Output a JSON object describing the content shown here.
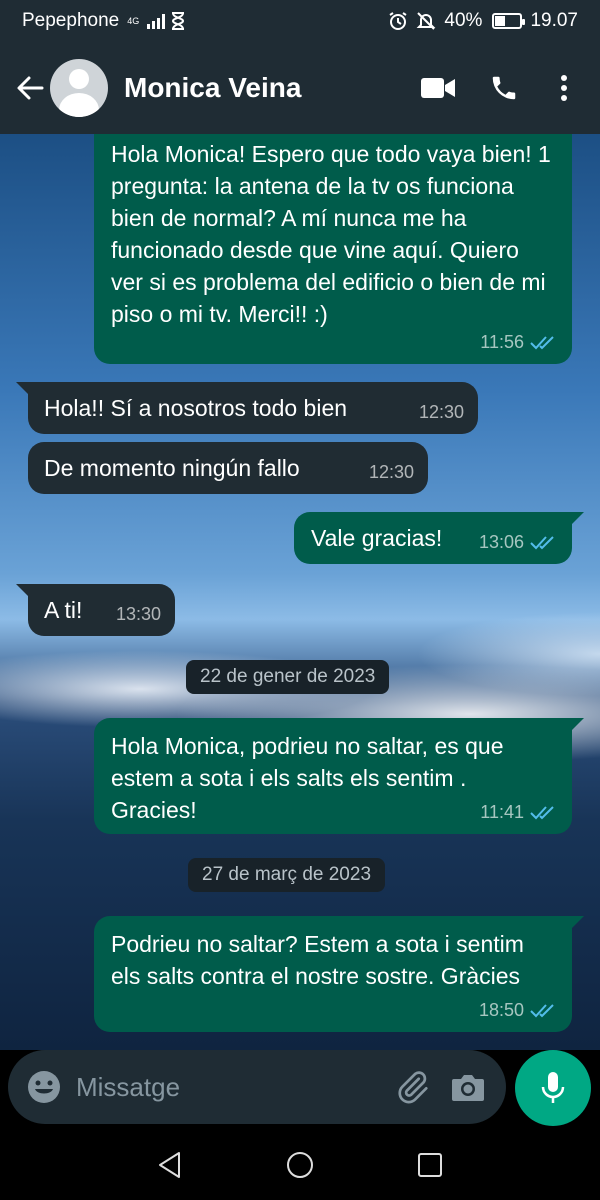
{
  "status_bar": {
    "carrier": "Pepephone",
    "network": "4G",
    "battery": "40%",
    "battery_level": 0.4,
    "time": "19.07"
  },
  "header": {
    "contact_name": "Monica Veina"
  },
  "messages": [
    {
      "direction": "out",
      "text": "Hola Monica! Espero que todo vaya bien! 1 pregunta: la antena de la tv os funciona bien de normal? A mí nunca me ha funcionado desde que vine aquí. Quiero ver si es problema del edificio o bien de mi piso o mi tv. Merci!! :)",
      "time": "11:56",
      "status": "read"
    },
    {
      "direction": "in",
      "text": "Hola!! Sí a nosotros todo bien",
      "time": "12:30"
    },
    {
      "direction": "in",
      "text": "De momento ningún fallo",
      "time": "12:30"
    },
    {
      "direction": "out",
      "text": "Vale gracias!",
      "time": "13:06",
      "status": "read"
    },
    {
      "direction": "in",
      "text": "A ti!",
      "time": "13:30"
    },
    {
      "date_separator": "22 de gener de 2023"
    },
    {
      "direction": "out",
      "text": "Hola Monica, podrieu no saltar, es que estem a sota i els salts els sentim . Gracies!",
      "time": "11:41",
      "status": "read"
    },
    {
      "date_separator": "27 de març de 2023"
    },
    {
      "direction": "out",
      "text": "Podrieu no saltar? Estem a sota i sentim els salts contra el nostre sostre. Gràcies",
      "time": "18:50",
      "status": "read"
    }
  ],
  "compose": {
    "placeholder": "Missatge"
  },
  "colors": {
    "outgoing_bubble": "#005c4b",
    "incoming_bubble": "#202c33",
    "read_ticks": "#53bdeb",
    "accent": "#00a884"
  }
}
